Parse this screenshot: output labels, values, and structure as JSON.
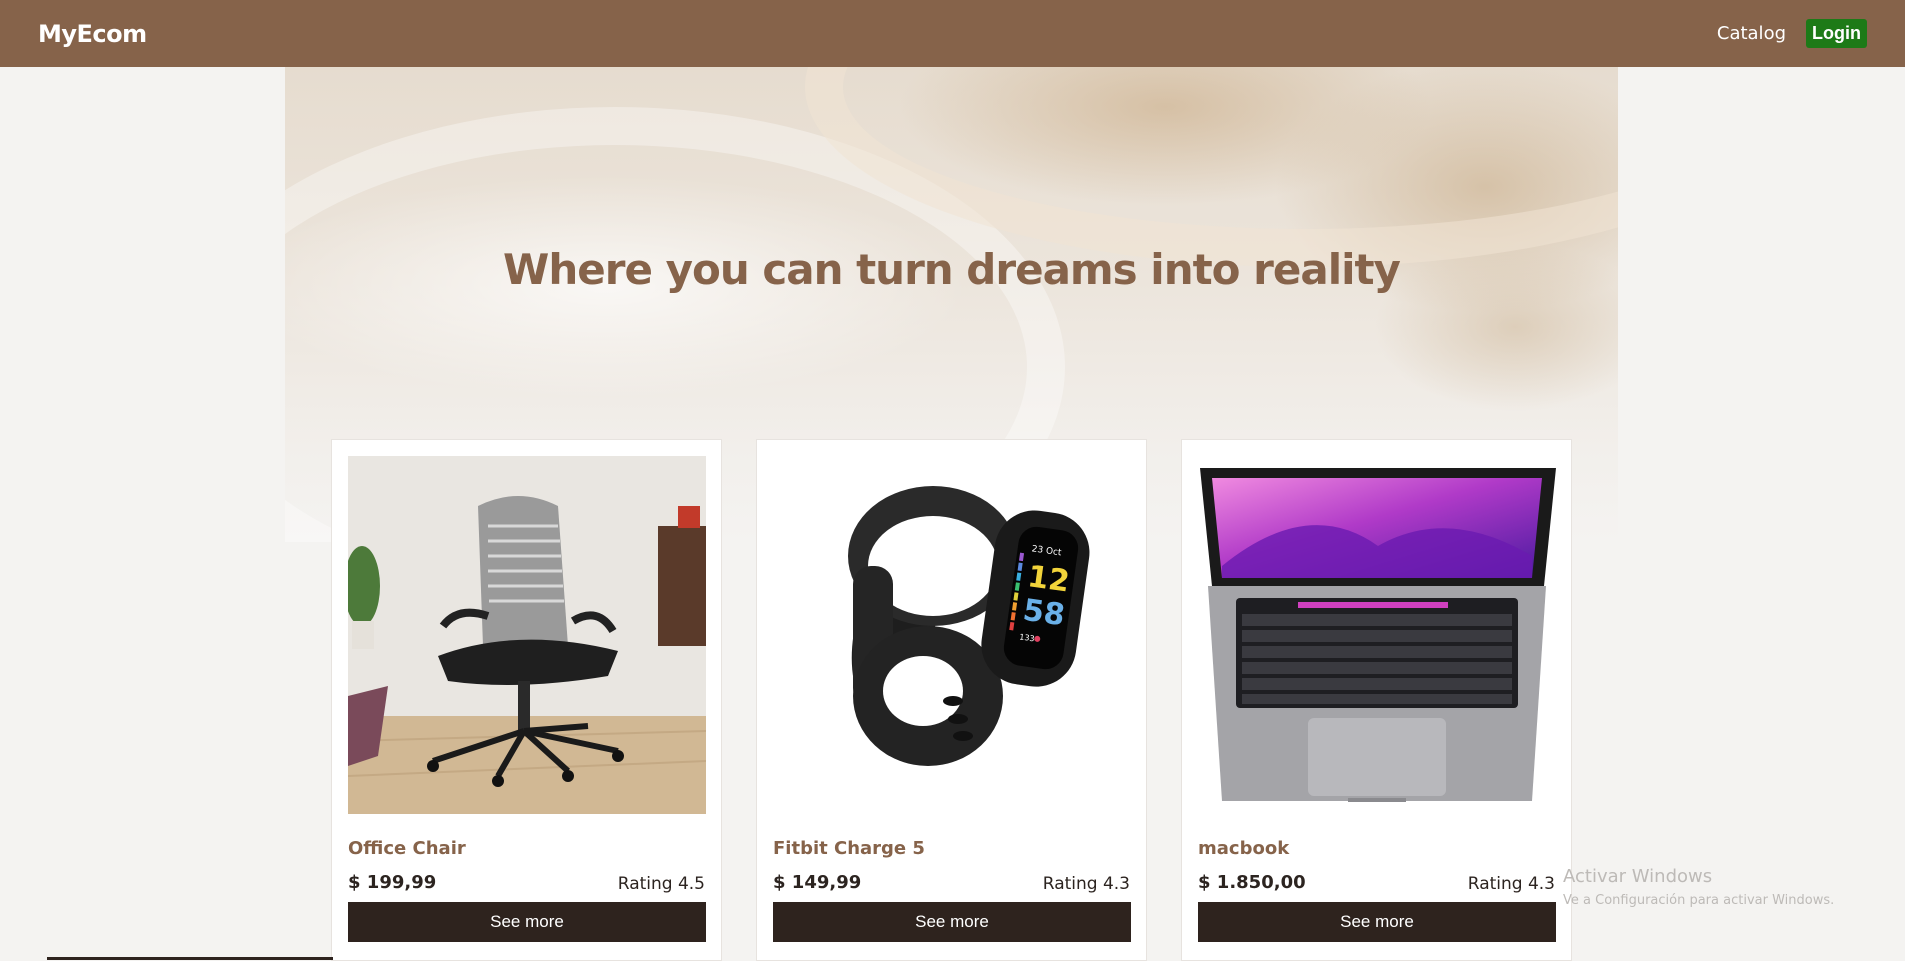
{
  "navbar": {
    "brand": "MyEcom",
    "catalog_label": "Catalog",
    "login_label": "Login"
  },
  "hero": {
    "title": "Where you can turn dreams into reality"
  },
  "products": [
    {
      "name": "Office Chair",
      "price": "$ 199,99",
      "rating": "Rating 4.5",
      "button": "See more",
      "image_icon": "office-chair-image"
    },
    {
      "name": "Fitbit Charge 5",
      "price": "$ 149,99",
      "rating": "Rating 4.3",
      "button": "See more",
      "image_icon": "fitbit-watch-image",
      "watch_date": "23 Oct",
      "watch_hour": "12",
      "watch_minute": "58",
      "watch_hr": "133"
    },
    {
      "name": "macbook",
      "price": "$ 1.850,00",
      "rating": "Rating 4.3",
      "button": "See more",
      "image_icon": "laptop-image"
    }
  ],
  "watermark": {
    "title": "Activar Windows",
    "subtitle": "Ve a Configuración para activar Windows."
  },
  "colors": {
    "navbar": "#86634a",
    "login": "#1d7a17",
    "button": "#2e231e",
    "accent_text": "#86634a"
  }
}
